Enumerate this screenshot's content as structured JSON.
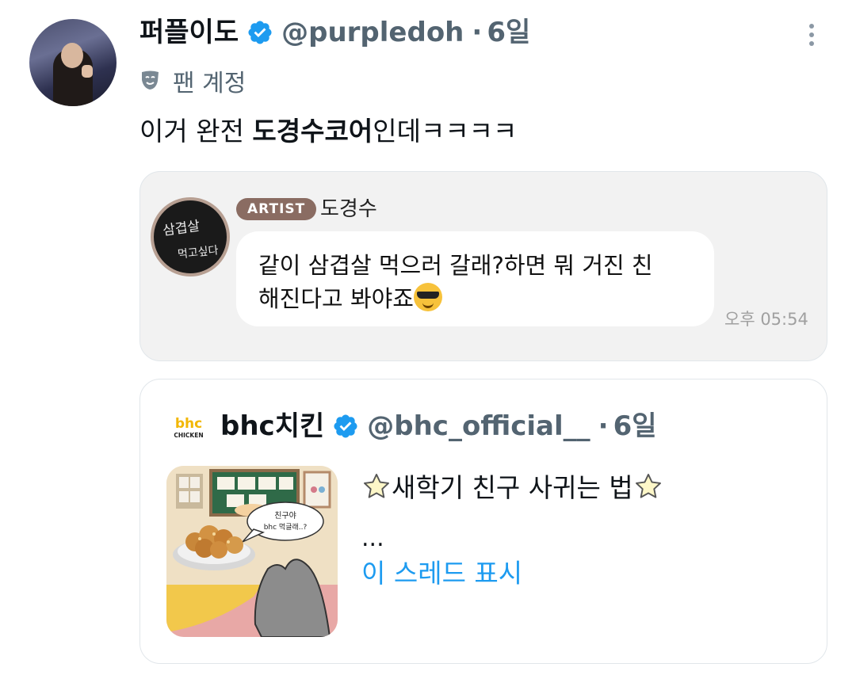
{
  "tweet": {
    "display_name": "퍼플이도",
    "handle": "@purpledoh",
    "separator": "·",
    "time": "6일",
    "fan_label": "팬 계정",
    "text_prefix": "이거 완전 ",
    "text_bold": "도경수코어",
    "text_suffix": "인데ㅋㅋㅋㅋ"
  },
  "quoted_message": {
    "badge": "ARTIST",
    "artist_name": "도경수",
    "avatar_text_line1": "삼겹살",
    "avatar_text_line2": "먹고싶다",
    "message_line1": "같이 삼겹살 먹으러 갈래?하면 뭐 거진 친",
    "message_line2": "해진다고 봐야죠",
    "timestamp": "오후 05:54"
  },
  "quoted_tweet": {
    "logo_text_top": "bhc",
    "logo_text_bottom": "CHICKEN",
    "display_name": "bhc치킨",
    "handle": "@bhc_official__",
    "separator": "·",
    "time": "6일",
    "thumb_bubble_line1": "친구야",
    "thumb_bubble_line2": "bhc 먹글래..?",
    "title": "새학기 친구 사귀는 법",
    "ellipsis": "...",
    "show_thread": "이 스레드 표시"
  },
  "colors": {
    "verified_blue": "#1d9bf0",
    "link_blue": "#1d9bf0",
    "artist_badge": "#8a6c62"
  },
  "icons": {
    "verified": "verified-badge-icon",
    "fan_mask": "theater-mask-icon",
    "more": "more-vertical-icon",
    "star": "star-emoji-icon",
    "sunglasses": "sunglasses-emoji-icon"
  }
}
